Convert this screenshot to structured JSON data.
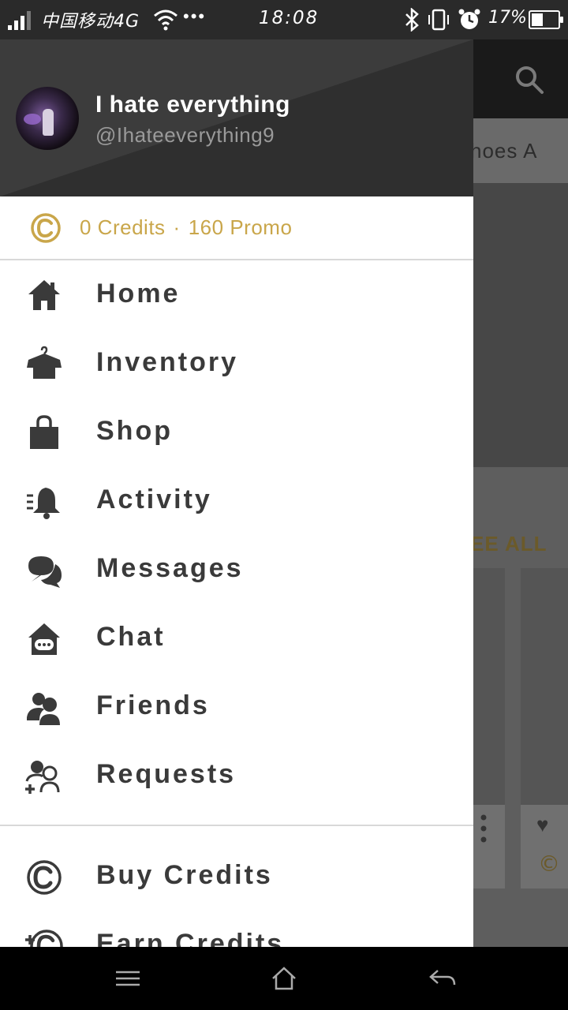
{
  "status_bar": {
    "carrier": "中国移动4G",
    "dots": "•••",
    "time": "18:08",
    "battery_percent": "17%",
    "battery_level": 0.17,
    "icons": [
      "signal-icon",
      "wifi-icon",
      "bluetooth-icon",
      "vibrate-icon",
      "alarm-icon",
      "battery-icon"
    ]
  },
  "drawer": {
    "user": {
      "name": "I hate everything",
      "handle": "@Ihateeverything9"
    },
    "credits": {
      "credits_text": "0 Credits",
      "separator": "·",
      "promo_text": "160 Promo",
      "accent_color": "#c9a64a"
    },
    "menu_items": [
      {
        "label": "Home",
        "icon": "home-icon"
      },
      {
        "label": "Inventory",
        "icon": "hanger-shirt-icon"
      },
      {
        "label": "Shop",
        "icon": "shopping-bag-icon"
      },
      {
        "label": "Activity",
        "icon": "bell-icon"
      },
      {
        "label": "Messages",
        "icon": "speech-bubbles-icon"
      },
      {
        "label": "Chat",
        "icon": "chat-house-icon"
      },
      {
        "label": "Friends",
        "icon": "friends-icon"
      },
      {
        "label": "Requests",
        "icon": "add-friend-icon"
      },
      {
        "label": "Buy Credits",
        "icon": "credits-icon"
      },
      {
        "label": "Earn Credits",
        "icon": "earn-credits-icon"
      }
    ]
  },
  "background_app": {
    "tab_partial": "hoes  A",
    "see_all_partial": "EE ALL"
  },
  "nav_bar": {
    "icons": [
      "menu-icon",
      "home-icon",
      "back-icon"
    ]
  }
}
